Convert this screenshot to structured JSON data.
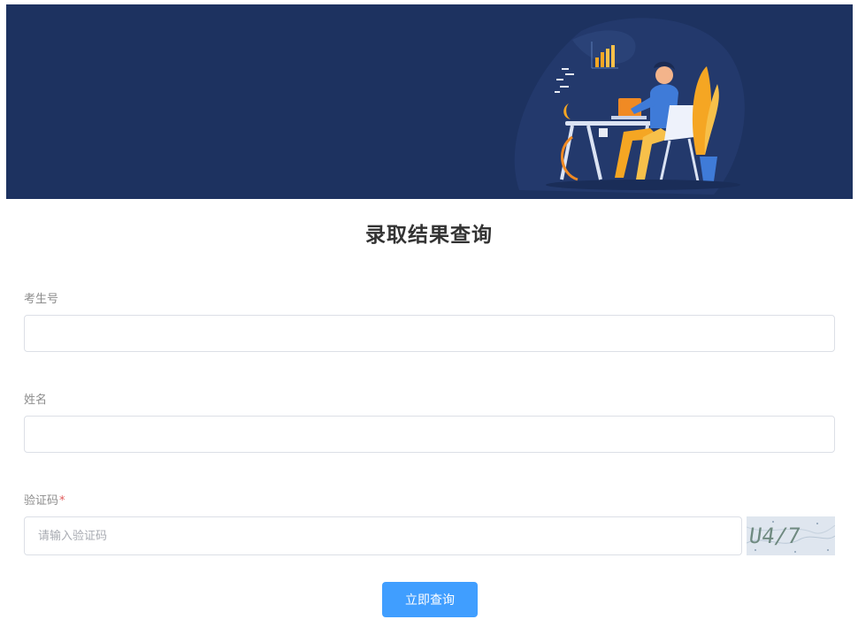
{
  "banner": {
    "illustration": "person-at-desk-with-computer",
    "background_color": "#1d3260"
  },
  "page": {
    "title": "录取结果查询"
  },
  "form": {
    "exam_number": {
      "label": "考生号",
      "value": "",
      "placeholder": ""
    },
    "name": {
      "label": "姓名",
      "value": "",
      "placeholder": ""
    },
    "captcha": {
      "label": "验证码",
      "required_mark": "*",
      "value": "",
      "placeholder": "请输入验证码",
      "image_text": "U4/7"
    },
    "submit_label": "立即查询"
  },
  "colors": {
    "primary_button": "#409eff",
    "required_mark": "#e05a5a",
    "label_text": "#8c8c8c",
    "input_border": "#dcdfe6"
  }
}
